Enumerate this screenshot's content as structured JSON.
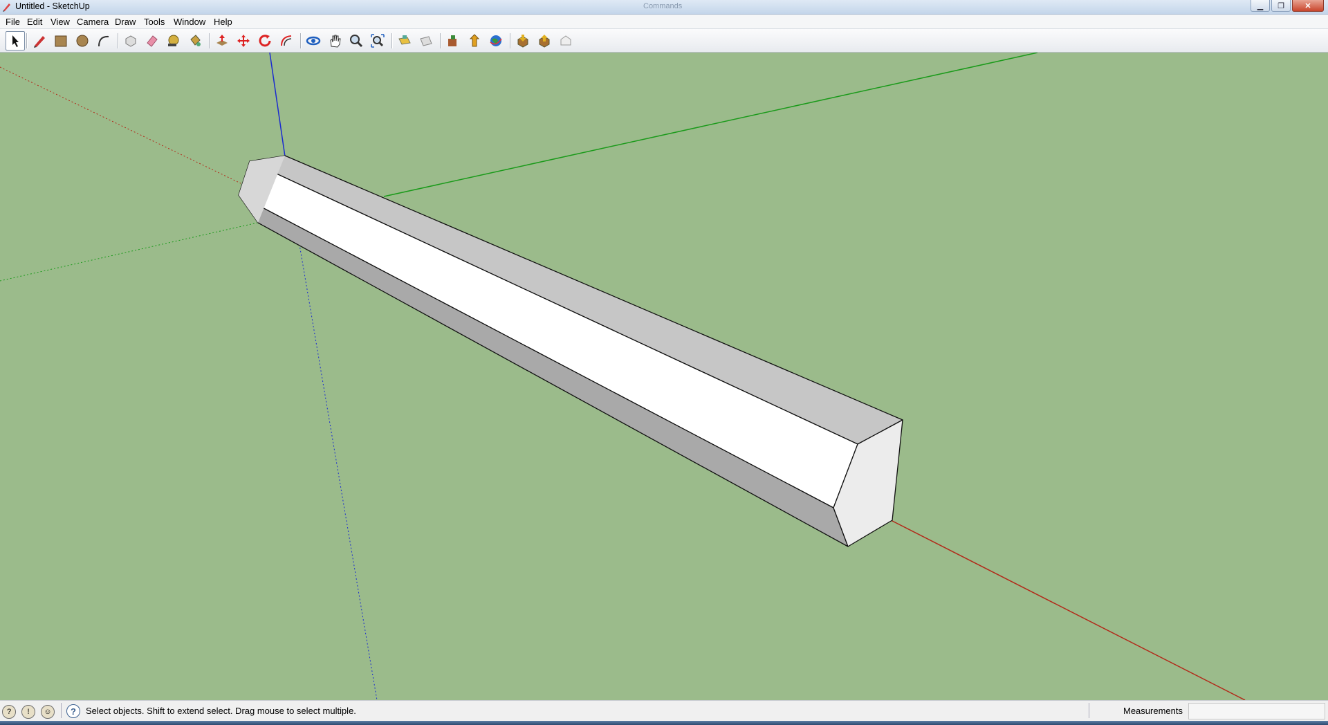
{
  "window": {
    "title": "Untitled - SketchUp",
    "ghost_title": "Commands",
    "buttons": {
      "minimize": "▁",
      "maximize": "❐",
      "close": "✕"
    }
  },
  "menu": [
    "File",
    "Edit",
    "View",
    "Camera",
    "Draw",
    "Tools",
    "Window",
    "Help"
  ],
  "toolbar": [
    "select-icon",
    "pencil-icon",
    "rectangle-icon",
    "circle-icon",
    "arc-icon",
    "make-component-icon",
    "eraser-icon",
    "tape-measure-icon",
    "paint-bucket-icon",
    "push-pull-icon",
    "move-icon",
    "rotate-icon",
    "offset-icon",
    "orbit-icon",
    "pan-icon",
    "zoom-icon",
    "zoom-extents-icon",
    "add-location-icon",
    "toggle-terrain-icon",
    "get-models-icon",
    "share-model-icon",
    "google-earth-icon",
    "get-models-3d-icon",
    "share-component-icon",
    "extension-warehouse-icon"
  ],
  "colors": {
    "viewport": "#9bbb8b",
    "red_axis": "#b22a1a",
    "green_axis": "#1a9a1a",
    "blue_axis": "#1a2ad0"
  },
  "status": {
    "message": "Select objects. Shift to extend select. Drag mouse to select multiple.",
    "measurements_label": "Measurements",
    "measurements_value": ""
  }
}
